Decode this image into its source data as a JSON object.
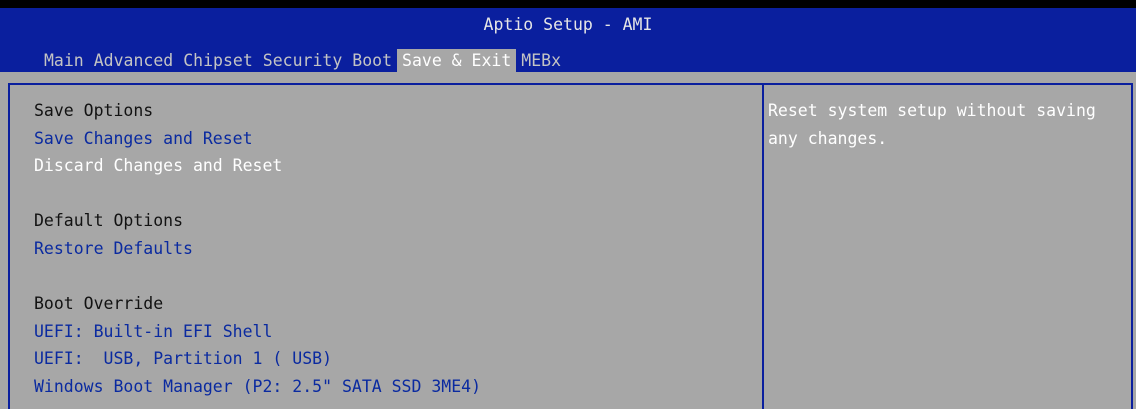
{
  "header": {
    "title": "Aptio Setup - AMI",
    "tabs": [
      "Main",
      "Advanced",
      "Chipset",
      "Security",
      "Boot",
      "Save & Exit",
      "MEBx"
    ]
  },
  "menu": {
    "save_heading": "Save Options",
    "save_changes_reset": "Save Changes and Reset",
    "discard_changes_reset": "Discard Changes and Reset",
    "default_heading": "Default Options",
    "restore_defaults": "Restore Defaults",
    "boot_heading": "Boot Override",
    "boot_items": [
      "UEFI: Built-in EFI Shell",
      "UEFI:  USB, Partition 1 ( USB)",
      "Windows Boot Manager (P2: 2.5\" SATA SSD 3ME4)"
    ]
  },
  "help": {
    "text": "Reset system setup without saving any changes."
  },
  "colors": {
    "header_blue": "#0a1f9e",
    "panel_gray": "#a7a7a7",
    "link_blue": "#0a2aa0",
    "selected_white": "#ffffff"
  }
}
